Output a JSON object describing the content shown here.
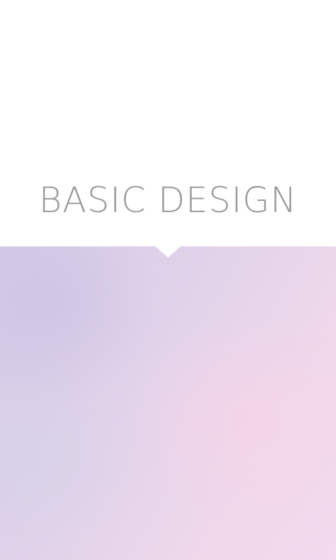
{
  "screen": {
    "title": "BASIC DESIGN"
  },
  "colors": {
    "background": "#ffffff",
    "title_text": "#9a9a9a",
    "gradient_start": "#d5cbe6",
    "gradient_end": "#f2dbee"
  }
}
